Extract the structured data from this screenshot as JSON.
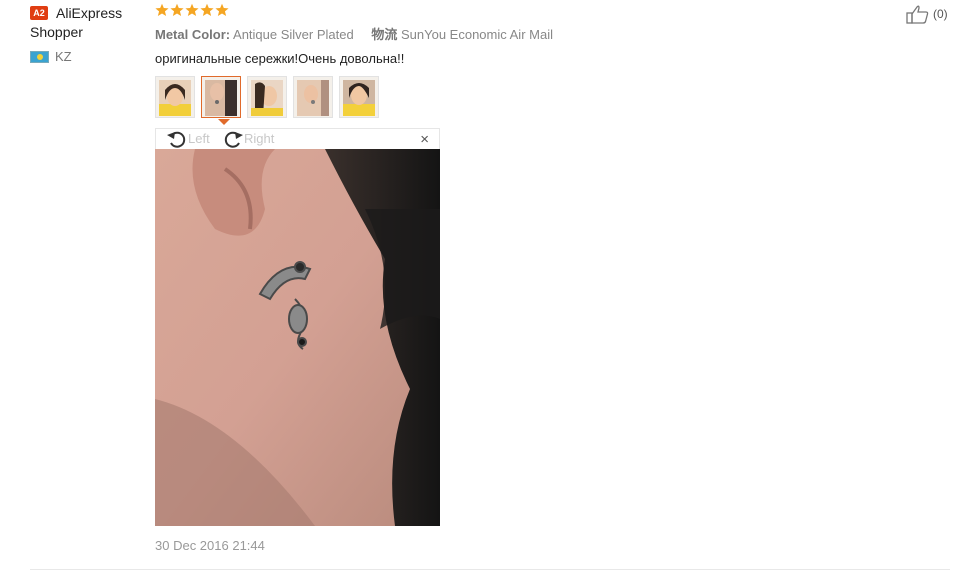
{
  "user": {
    "level_badge": "A2",
    "name_line1": "AliExpress",
    "name_line2": "Shopper",
    "country_code": "KZ"
  },
  "review": {
    "rating": 5,
    "star_color": "#f5a623",
    "metal_color_key": "Metal Color:",
    "metal_color_value": "Antique Silver Plated",
    "shipping_key": "物流",
    "shipping_value": "SunYou Economic Air Mail",
    "text": "оригинальные сережки!Очень довольна!!",
    "timestamp": "30 Dec 2016 21:44"
  },
  "viewer": {
    "rotate_left_label": "Left",
    "rotate_right_label": "Right",
    "close_label": "×",
    "active_thumb_index": 1,
    "thumb_count": 5
  },
  "like": {
    "count_label": "(0)"
  },
  "colors": {
    "accent": "#e06a2b",
    "badge": "#e03d12"
  }
}
